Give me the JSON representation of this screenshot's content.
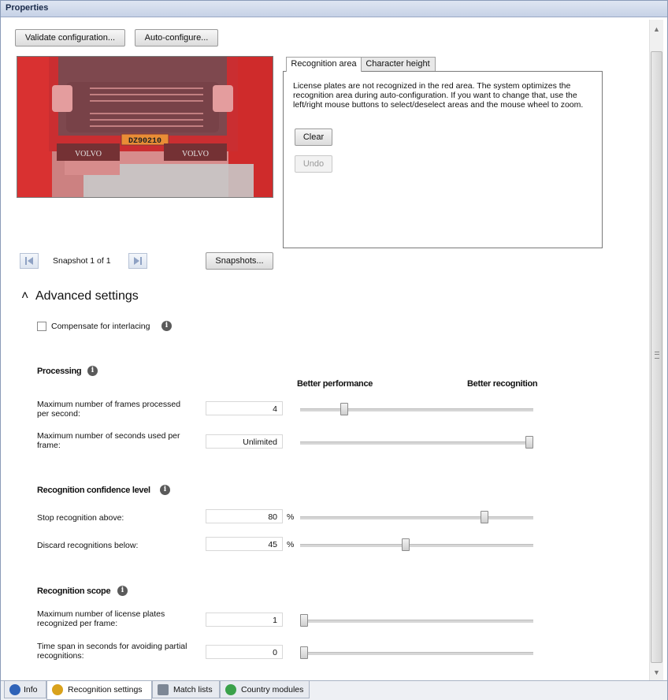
{
  "window": {
    "title": "Properties"
  },
  "toolbar": {
    "validate_label": "Validate configuration...",
    "autoconfig_label": "Auto-configure..."
  },
  "preview": {
    "plate_text": "DZ90210",
    "brand_left": "VOLVO",
    "brand_right": "VOLVO"
  },
  "tabs": [
    {
      "label": "Recognition area",
      "active": true
    },
    {
      "label": "Character height",
      "active": false
    }
  ],
  "recognition_area": {
    "text": "License plates are not recognized in the red area. The system optimizes the recognition area during auto-configuration. If you want to change that, use the left/right mouse buttons to select/deselect areas and the mouse wheel to zoom.",
    "clear_label": "Clear",
    "undo_label": "Undo"
  },
  "snapshot": {
    "label": "Snapshot 1 of 1",
    "snapshots_button": "Snapshots..."
  },
  "advanced": {
    "toggle_glyph": "˄",
    "title": "Advanced settings",
    "compensate_label": "Compensate for interlacing",
    "compensate_checked": false
  },
  "processing": {
    "title": "Processing",
    "left_header": "Better performance",
    "right_header": "Better recognition",
    "rows": [
      {
        "label": "Maximum number of frames processed per second:",
        "value": "4",
        "unit": "",
        "slider": 0.18
      },
      {
        "label": "Maximum number of seconds used per frame:",
        "value": "Unlimited",
        "unit": "",
        "slider": 1.0
      }
    ]
  },
  "confidence": {
    "title": "Recognition confidence level",
    "rows": [
      {
        "label": "Stop recognition above:",
        "value": "80",
        "unit": "%",
        "slider": 0.8
      },
      {
        "label": "Discard recognitions below:",
        "value": "45",
        "unit": "%",
        "slider": 0.45
      }
    ]
  },
  "scope": {
    "title": "Recognition scope",
    "rows": [
      {
        "label": "Maximum number of license plates recognized per frame:",
        "value": "1",
        "unit": "",
        "slider": 0.0
      },
      {
        "label": "Time span in seconds for avoiding partial recognitions:",
        "value": "0",
        "unit": "",
        "slider": 0.0
      }
    ]
  },
  "bottom_tabs": [
    {
      "label": "Info",
      "icon": "info-icon",
      "active": false
    },
    {
      "label": "Recognition settings",
      "icon": "recognition-settings-icon",
      "active": true
    },
    {
      "label": "Match lists",
      "icon": "match-lists-icon",
      "active": false
    },
    {
      "label": "Country modules",
      "icon": "country-modules-icon",
      "active": false
    }
  ],
  "colors": {
    "mask_red": "#e0393a",
    "title_blue": "#c6d2e6"
  }
}
